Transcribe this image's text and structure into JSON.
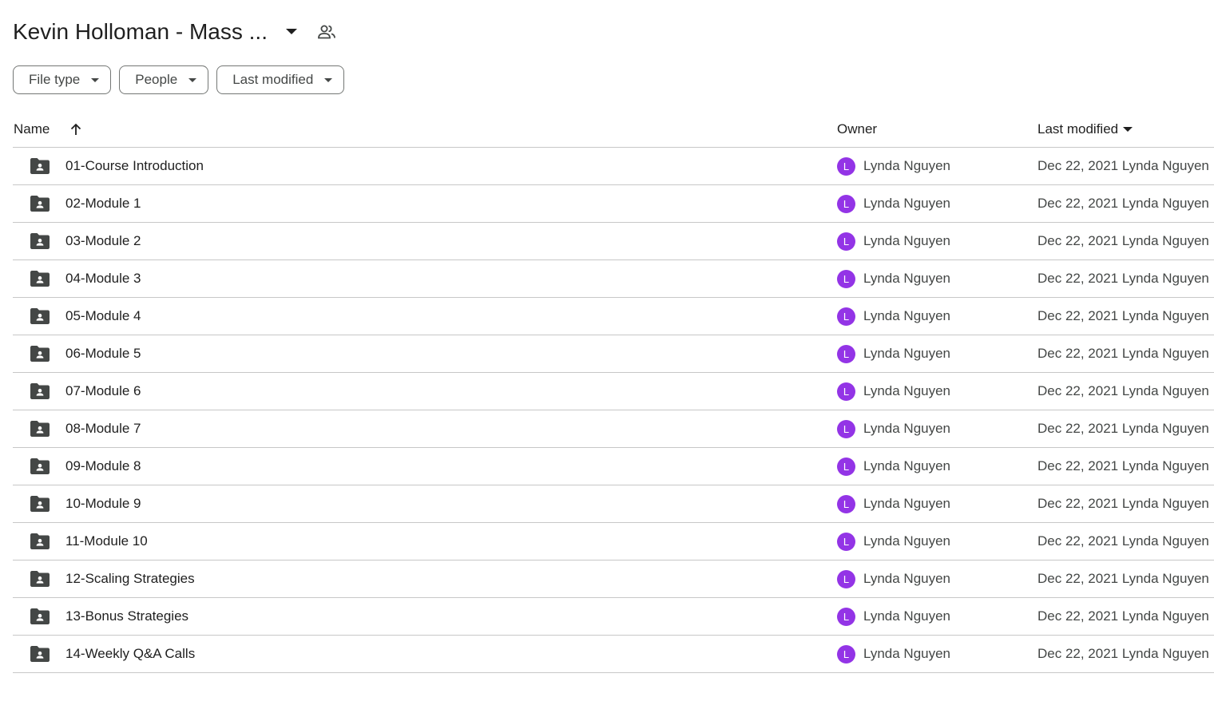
{
  "header": {
    "title": "Kevin Holloman - Mass ...",
    "caret_icon": "arrow-drop-down-icon",
    "share_icon": "people-icon"
  },
  "filters": [
    {
      "label": "File type"
    },
    {
      "label": "People"
    },
    {
      "label": "Last modified"
    }
  ],
  "table": {
    "columns": {
      "name": "Name",
      "owner": "Owner",
      "last_modified": "Last modified"
    },
    "rows": [
      {
        "name": "01-Course Introduction",
        "owner_initial": "L",
        "owner": "Lynda Nguyen",
        "modified": "Dec 22, 2021 Lynda Nguyen"
      },
      {
        "name": "02-Module 1",
        "owner_initial": "L",
        "owner": "Lynda Nguyen",
        "modified": "Dec 22, 2021 Lynda Nguyen"
      },
      {
        "name": "03-Module 2",
        "owner_initial": "L",
        "owner": "Lynda Nguyen",
        "modified": "Dec 22, 2021 Lynda Nguyen"
      },
      {
        "name": "04-Module 3",
        "owner_initial": "L",
        "owner": "Lynda Nguyen",
        "modified": "Dec 22, 2021 Lynda Nguyen"
      },
      {
        "name": "05-Module 4",
        "owner_initial": "L",
        "owner": "Lynda Nguyen",
        "modified": "Dec 22, 2021 Lynda Nguyen"
      },
      {
        "name": "06-Module 5",
        "owner_initial": "L",
        "owner": "Lynda Nguyen",
        "modified": "Dec 22, 2021 Lynda Nguyen"
      },
      {
        "name": "07-Module 6",
        "owner_initial": "L",
        "owner": "Lynda Nguyen",
        "modified": "Dec 22, 2021 Lynda Nguyen"
      },
      {
        "name": "08-Module 7",
        "owner_initial": "L",
        "owner": "Lynda Nguyen",
        "modified": "Dec 22, 2021 Lynda Nguyen"
      },
      {
        "name": "09-Module 8",
        "owner_initial": "L",
        "owner": "Lynda Nguyen",
        "modified": "Dec 22, 2021 Lynda Nguyen"
      },
      {
        "name": "10-Module 9",
        "owner_initial": "L",
        "owner": "Lynda Nguyen",
        "modified": "Dec 22, 2021 Lynda Nguyen"
      },
      {
        "name": "11-Module 10",
        "owner_initial": "L",
        "owner": "Lynda Nguyen",
        "modified": "Dec 22, 2021 Lynda Nguyen"
      },
      {
        "name": "12-Scaling Strategies",
        "owner_initial": "L",
        "owner": "Lynda Nguyen",
        "modified": "Dec 22, 2021 Lynda Nguyen"
      },
      {
        "name": "13-Bonus Strategies",
        "owner_initial": "L",
        "owner": "Lynda Nguyen",
        "modified": "Dec 22, 2021 Lynda Nguyen"
      },
      {
        "name": "14-Weekly Q&A Calls",
        "owner_initial": "L",
        "owner": "Lynda Nguyen",
        "modified": "Dec 22, 2021 Lynda Nguyen"
      }
    ]
  },
  "colors": {
    "avatar": "#9334e6",
    "icon": "#444746",
    "divider": "#c7c7c7"
  }
}
